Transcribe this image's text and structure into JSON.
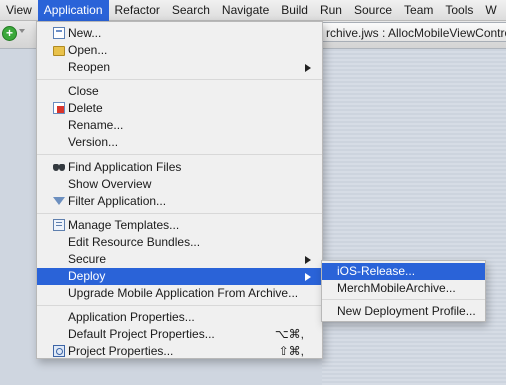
{
  "menubar": {
    "items": [
      {
        "label": "View"
      },
      {
        "label": "Application"
      },
      {
        "label": "Refactor"
      },
      {
        "label": "Search"
      },
      {
        "label": "Navigate"
      },
      {
        "label": "Build"
      },
      {
        "label": "Run"
      },
      {
        "label": "Source"
      },
      {
        "label": "Team"
      },
      {
        "label": "Tools"
      },
      {
        "label": "W"
      }
    ],
    "active": "Application"
  },
  "editor": {
    "tab_title": "rchive.jws : AllocMobileViewController.j"
  },
  "toolbar": {
    "add_icon": "add-circle-icon",
    "add_glyph": "+"
  },
  "application_menu": {
    "items": [
      {
        "label": "New...",
        "icon": "new-icon"
      },
      {
        "label": "Open...",
        "icon": "folder-icon"
      },
      {
        "label": "Reopen",
        "submenu": true
      },
      {
        "label": "Close"
      },
      {
        "label": "Delete",
        "icon": "delete-icon"
      },
      {
        "label": "Rename..."
      },
      {
        "label": "Version..."
      },
      {
        "label": "Find Application Files",
        "icon": "binoculars-icon"
      },
      {
        "label": "Show Overview"
      },
      {
        "label": "Filter Application...",
        "icon": "filter-icon"
      },
      {
        "label": "Manage Templates...",
        "icon": "templates-icon"
      },
      {
        "label": "Edit Resource Bundles..."
      },
      {
        "label": "Secure",
        "submenu": true
      },
      {
        "label": "Deploy",
        "submenu": true,
        "highlighted": true
      },
      {
        "label": "Upgrade Mobile Application From Archive..."
      },
      {
        "label": "Application Properties..."
      },
      {
        "label": "Default Project Properties...",
        "shortcut": "⌥⌘,"
      },
      {
        "label": "Project Properties...",
        "icon": "properties-icon",
        "shortcut": "⇧⌘,"
      }
    ]
  },
  "deploy_submenu": {
    "items": [
      {
        "label": "iOS-Release...",
        "highlighted": true
      },
      {
        "label": "MerchMobileArchive..."
      },
      {
        "label": "New Deployment Profile..."
      }
    ]
  },
  "colors": {
    "highlight": "#2a63d8",
    "menu_bg": "#f0f0f0"
  }
}
